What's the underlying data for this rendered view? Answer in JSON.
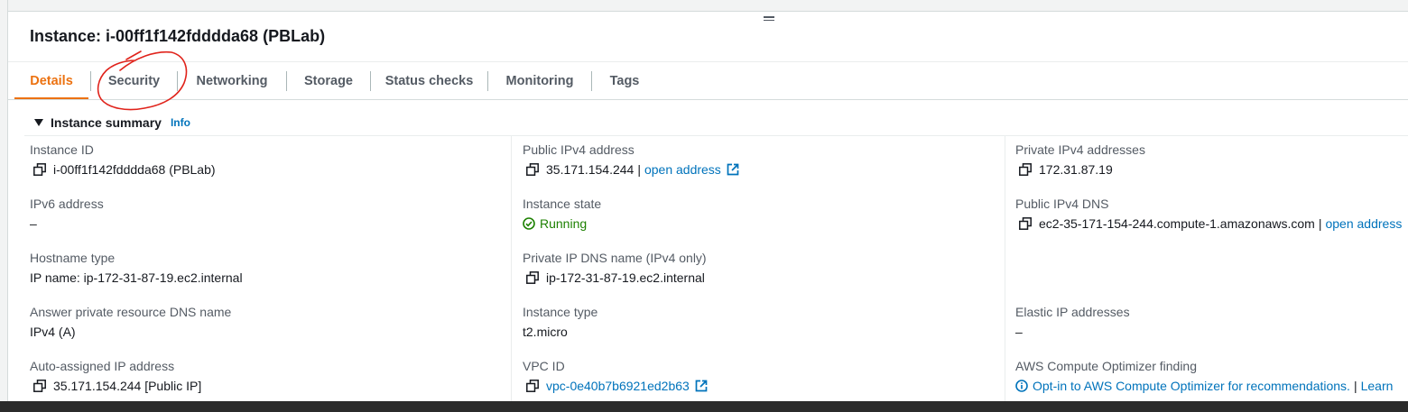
{
  "instance": {
    "title": "Instance: i-00ff1f142fdddda68 (PBLab)"
  },
  "tabs": [
    {
      "label": "Details"
    },
    {
      "label": "Security"
    },
    {
      "label": "Networking"
    },
    {
      "label": "Storage"
    },
    {
      "label": "Status checks"
    },
    {
      "label": "Monitoring"
    },
    {
      "label": "Tags"
    }
  ],
  "summary": {
    "title": "Instance summary",
    "info": "Info"
  },
  "col1": {
    "instance_id_label": "Instance ID",
    "instance_id": "i-00ff1f142fdddda68 (PBLab)",
    "ipv6_label": "IPv6 address",
    "ipv6": "–",
    "hostname_type_label": "Hostname type",
    "hostname_type": "IP name: ip-172-31-87-19.ec2.internal",
    "answer_dns_label": "Answer private resource DNS name",
    "answer_dns": "IPv4 (A)",
    "auto_ip_label": "Auto-assigned IP address",
    "auto_ip": "35.171.154.244 [Public IP]"
  },
  "col2": {
    "public_ipv4_label": "Public IPv4 address",
    "public_ipv4": "35.171.154.244",
    "separator": "|",
    "open_address": "open address",
    "state_label": "Instance state",
    "state": "Running",
    "private_dns_label": "Private IP DNS name (IPv4 only)",
    "private_dns": "ip-172-31-87-19.ec2.internal",
    "type_label": "Instance type",
    "type": "t2.micro",
    "vpc_label": "VPC ID",
    "vpc": "vpc-0e40b7b6921ed2b63"
  },
  "col3": {
    "private_ipv4_label": "Private IPv4 addresses",
    "private_ipv4": "172.31.87.19",
    "public_dns_label": "Public IPv4 DNS",
    "public_dns": "ec2-35-171-154-244.compute-1.amazonaws.com",
    "separator": "|",
    "open_address": "open address",
    "elastic_label": "Elastic IP addresses",
    "elastic": "–",
    "optimizer_label": "AWS Compute Optimizer finding",
    "optimizer": "Opt-in to AWS Compute Optimizer for recommendations.",
    "learn": "Learn"
  },
  "colors": {
    "accent": "#ec7211",
    "link": "#0073bb",
    "success": "#1d8102",
    "annotation": "#e0231b"
  }
}
